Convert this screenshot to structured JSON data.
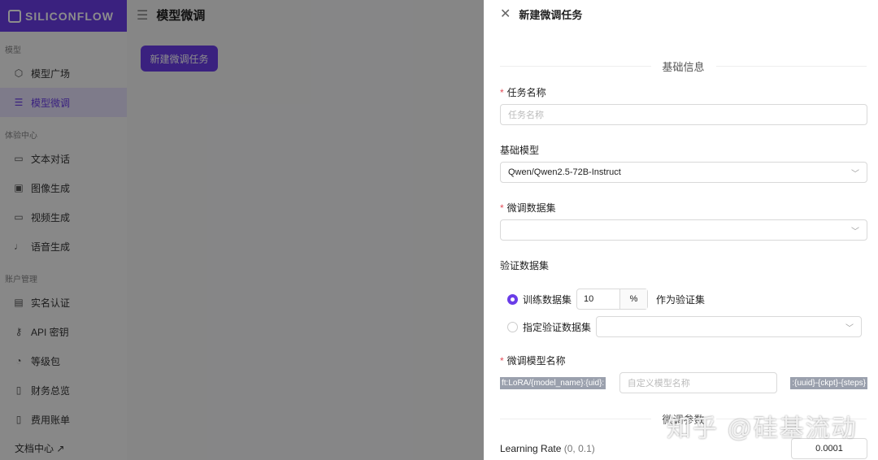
{
  "brand": "SILICONFLOW",
  "page_title": "模型微调",
  "new_task_button": "新建微调任务",
  "sidebar": {
    "groups": [
      {
        "label": "模型",
        "items": [
          {
            "label": "模型广场",
            "icon": "cube-icon"
          },
          {
            "label": "模型微调",
            "icon": "sliders-icon",
            "active": true
          }
        ]
      },
      {
        "label": "体验中心",
        "items": [
          {
            "label": "文本对话",
            "icon": "chat-icon"
          },
          {
            "label": "图像生成",
            "icon": "image-icon"
          },
          {
            "label": "视频生成",
            "icon": "video-icon"
          },
          {
            "label": "语音生成",
            "icon": "mic-icon"
          }
        ]
      },
      {
        "label": "账户管理",
        "items": [
          {
            "label": "实名认证",
            "icon": "id-card-icon"
          },
          {
            "label": "API 密钥",
            "icon": "key-icon"
          },
          {
            "label": "等级包",
            "icon": "gauge-icon"
          },
          {
            "label": "财务总览",
            "icon": "finance-icon"
          },
          {
            "label": "费用账单",
            "icon": "bill-icon"
          }
        ]
      }
    ],
    "docs": "文档中心 ↗"
  },
  "drawer": {
    "title": "新建微调任务",
    "section_basic": "基础信息",
    "task_name_label": "任务名称",
    "task_name_placeholder": "任务名称",
    "base_model_label": "基础模型",
    "base_model_value": "Qwen/Qwen2.5-72B-Instruct",
    "dataset_label": "微调数据集",
    "val_label": "验证数据集",
    "val_opt1": "训练数据集",
    "val_percent": "10",
    "percent_sign": "%",
    "val_opt1_suffix": "作为验证集",
    "val_opt2": "指定验证数据集",
    "model_name_label": "微调模型名称",
    "prefix": "ft:LoRA/{model_name}:{uid}:",
    "model_name_placeholder": "自定义模型名称",
    "suffix": ":{uuid}-{ckpt}-{steps}",
    "section_params": "微调参数",
    "lr_label": "Learning Rate",
    "lr_range": "(0, 0.1)",
    "lr_value": "0.0001"
  },
  "watermark": "知乎 @硅基流动"
}
